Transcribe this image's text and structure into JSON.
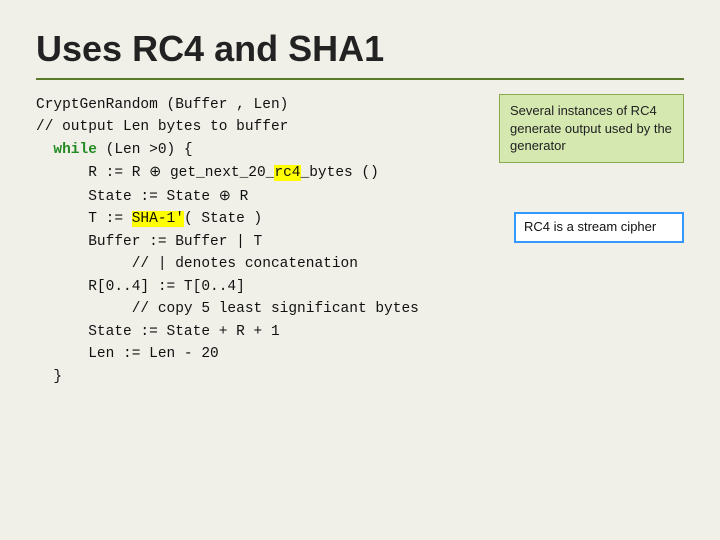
{
  "slide": {
    "title": "Uses RC4 and SHA1",
    "sidebar_note": {
      "text": "Several instances of RC4 generate output used by the generator"
    },
    "rc4_stream_note": {
      "text": "RC4 is a stream cipher"
    },
    "code_lines": [
      {
        "id": "line1",
        "text": "CryptGenRandom (Buffer , Len)"
      },
      {
        "id": "line2",
        "text": "// output Len bytes to buffer"
      },
      {
        "id": "line3",
        "text": "  while (Len >0) {"
      },
      {
        "id": "line4",
        "text": "      R := R ⊕ get_next_20_rc4_bytes ()"
      },
      {
        "id": "line5",
        "text": "      State := State ⊕ R"
      },
      {
        "id": "line6",
        "text": "      T := SHA-1'( State )"
      },
      {
        "id": "line7",
        "text": "      Buffer := Buffer | T"
      },
      {
        "id": "line8",
        "text": "           // | denotes concatenation"
      },
      {
        "id": "line9",
        "text": "      R[0..4] := T[0..4]"
      },
      {
        "id": "line10",
        "text": "           // copy 5 least significant bytes"
      },
      {
        "id": "line11",
        "text": "      State := State + R + 1"
      },
      {
        "id": "line12",
        "text": "      Len := Len - 20"
      },
      {
        "id": "line13",
        "text": "  }"
      }
    ]
  }
}
